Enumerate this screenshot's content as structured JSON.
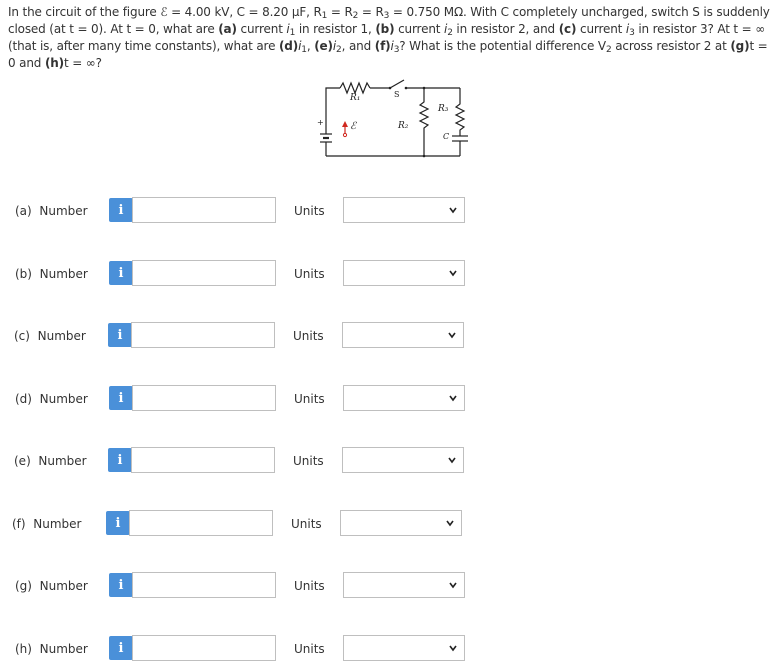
{
  "question": {
    "s1": "In the circuit of the figure ",
    "emf_symbol": "ℰ",
    "s2": " = 4.00 kV, C = 8.20 μF, R",
    "s3": " = R",
    "s4": " = R",
    "s5": " = 0.750 MΩ. With C completely uncharged, switch S is suddenly closed (at t = 0). At t = 0, what are ",
    "a": "(a)",
    "s6": " current ",
    "s7": " in resistor 1, ",
    "b": "(b)",
    "s8": " current ",
    "s9": " in resistor 2, and ",
    "c": "(c)",
    "s10": " current ",
    "s11": " in resistor 3? At t = ∞ (that is, after many time constants), what are ",
    "d": "(d)",
    "e": "(e)",
    "f": "(f)",
    "s12": "? What is the potential difference V",
    "s13": " across resistor 2 at ",
    "g": "(g)",
    "s14": "t = 0 and ",
    "h": "(h)",
    "s15": "t = ∞?",
    "i_letter": "i",
    "sub1": "1",
    "sub2": "2",
    "sub3": "3",
    "comma": ", "
  },
  "figure": {
    "r1_label": "R₁",
    "r2_label": "R₂",
    "r3_label": "R₃",
    "switch_label": "S",
    "cap_label": "C",
    "emf_label": "ℰ",
    "plus_label": "+"
  },
  "rows": [
    {
      "part": "(a)",
      "kind": "Number",
      "info": "i",
      "value": "",
      "units_label": "Units",
      "units_value": ""
    },
    {
      "part": "(b)",
      "kind": "Number",
      "info": "i",
      "value": "",
      "units_label": "Units",
      "units_value": ""
    },
    {
      "part": "(c)",
      "kind": "Number",
      "info": "i",
      "value": "",
      "units_label": "Units",
      "units_value": ""
    },
    {
      "part": "(d)",
      "kind": "Number",
      "info": "i",
      "value": "",
      "units_label": "Units",
      "units_value": ""
    },
    {
      "part": "(e)",
      "kind": "Number",
      "info": "i",
      "value": "",
      "units_label": "Units",
      "units_value": ""
    },
    {
      "part": "(f)",
      "kind": "Number",
      "info": "i",
      "value": "",
      "units_label": "Units",
      "units_value": ""
    },
    {
      "part": "(g)",
      "kind": "Number",
      "info": "i",
      "value": "",
      "units_label": "Units",
      "units_value": ""
    },
    {
      "part": "(h)",
      "kind": "Number",
      "info": "i",
      "value": "",
      "units_label": "Units",
      "units_value": ""
    }
  ],
  "colors": {
    "info_button": "#4a90d9",
    "input_border": "#bfbfbf",
    "text": "#333333",
    "emf_red": "#d0281f"
  },
  "icons": {
    "info": "info-icon",
    "dropdown": "chevron-down-icon"
  }
}
